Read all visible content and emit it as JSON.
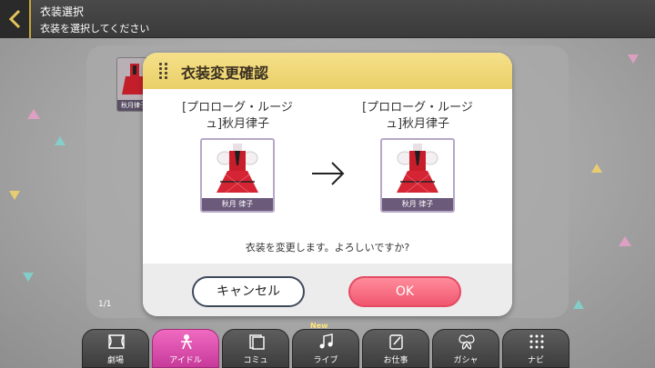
{
  "header": {
    "title": "衣装選択",
    "subtitle": "衣装を選択してください"
  },
  "list": {
    "thumb_name": "秋月律子",
    "page_indicator": "1/1"
  },
  "dialog": {
    "title": "衣装変更確認",
    "before": {
      "name_line1": "[プロローグ・ルージ",
      "name_line2": "ュ]秋月律子",
      "card_label": "秋月 律子"
    },
    "after": {
      "name_line1": "[プロローグ・ルージ",
      "name_line2": "ュ]秋月律子",
      "card_label": "秋月 律子"
    },
    "confirm_text": "衣装を変更します。よろしいですか?",
    "cancel_label": "キャンセル",
    "ok_label": "OK"
  },
  "nav": {
    "new_badge": "New",
    "items": [
      {
        "label": "劇場",
        "icon": "theater-icon"
      },
      {
        "label": "アイドル",
        "icon": "idol-icon",
        "active": true
      },
      {
        "label": "コミュ",
        "icon": "communication-icon"
      },
      {
        "label": "ライブ",
        "icon": "live-icon"
      },
      {
        "label": "お仕事",
        "icon": "work-icon"
      },
      {
        "label": "ガシャ",
        "icon": "gacha-icon"
      },
      {
        "label": "ナビ",
        "icon": "menu-icon"
      }
    ]
  },
  "colors": {
    "accent_gold": "#c9a43a",
    "dialog_header": "#f0d978",
    "ok_pink": "#f0576f",
    "nav_active": "#e055b0"
  }
}
